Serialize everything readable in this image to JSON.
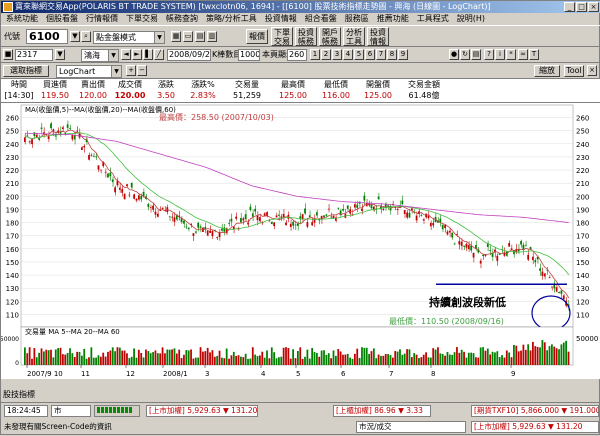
{
  "window": {
    "title": "寶來聯網交易App(POLARIS BT TRADE SYSTEM)  [twxclotn06, 1694]  - [[6100] 股票技術指標走勢圖 - 興海 (日線圖 - LogChart)]"
  },
  "menu": [
    "系統功能",
    "個股看盤",
    "行情報價",
    "下單交易",
    "帳務查詢",
    "策略/分析工具",
    "投資情報",
    "組合看盤",
    "服務區",
    "推薦功能",
    "工具程式",
    "說明(H)"
  ],
  "toolbar1": {
    "code_label": "代號",
    "code_value": "6100",
    "mode_value": "點金盤模式",
    "report_btn": "報價",
    "order_btn": "下單\n交易",
    "ledger_btn": "投資\n帳務",
    "cash_btn": "開戶\n帳務",
    "strategy_btn": "分析\n工具",
    "news_btn": "投資\n情報"
  },
  "toolbar2": {
    "code": "2317",
    "name": "鴻海",
    "date": "2008/09/26",
    "kline_label": "K棒數目",
    "kline_value": "1000",
    "display_label": "本頁顯示",
    "display_value": "260",
    "zoom_label": "縮放",
    "tool_label": "Tool"
  },
  "toolbar3": {
    "indicator_btn": "選取指標",
    "chart_type": "LogChart"
  },
  "quote": {
    "headers": [
      "時間",
      "買進價",
      "賣出價",
      "成交價",
      "漲跌",
      "漲跌%",
      "交易量",
      "最高價",
      "最低價",
      "開盤價",
      "交易金額"
    ],
    "values": [
      "[14:30]",
      "119.50",
      "120.00",
      "120.00",
      "3.50",
      "2.83%",
      "51,259",
      "125.00",
      "116.00",
      "125.00",
      "61.48億"
    ]
  },
  "chart": {
    "ma_legend": "MA(收盤價,5)--MA(收盤價,20)--MA(收盤價,60)",
    "high_label": "最高價：258.50 (2007/10/03)",
    "low_label": "最低價：110.50 (2008/09/16)",
    "annotation": "持續創波段新低",
    "volume_legend": "交易量 MA 5--MA 20--MA 60",
    "price_ticks": [
      "260",
      "250",
      "240",
      "230",
      "220",
      "210",
      "200",
      "190",
      "180",
      "170",
      "160",
      "150",
      "140",
      "130",
      "120",
      "110"
    ],
    "volume_ticks": [
      "50000",
      "0"
    ],
    "x_ticks": [
      "2007/9 10",
      "11",
      "12",
      "2008/1",
      "3",
      "4",
      "5",
      "6",
      "7",
      "8",
      "9"
    ],
    "colors": {
      "up": "#c00000",
      "down": "#008000",
      "ma5": "#c04040",
      "ma20": "#40c040",
      "ma60": "#c040c0",
      "support": "#0000a0"
    }
  },
  "chart_data": {
    "type": "candlestick",
    "title": "",
    "xlabel": "",
    "ylabel": "",
    "ylim": [
      110,
      265
    ],
    "x": [
      "2007/9",
      "2007/10",
      "2007/11",
      "2007/12",
      "2008/1",
      "2008/2",
      "2008/3",
      "2008/4",
      "2008/5",
      "2008/6",
      "2008/7",
      "2008/8",
      "2008/9"
    ],
    "close_approx": [
      245,
      252,
      210,
      190,
      170,
      185,
      182,
      190,
      195,
      180,
      155,
      162,
      120
    ],
    "ma60_approx": [
      248,
      247,
      242,
      232,
      222,
      208,
      200,
      196,
      194,
      190,
      186,
      184,
      180
    ],
    "annotations": {
      "high": {
        "value": 258.5,
        "date": "2007/10/03"
      },
      "low": {
        "value": 110.5,
        "date": "2008/09/16"
      },
      "support_line": 133
    }
  },
  "tabs": {
    "label": "股技指標"
  },
  "status": {
    "time": "18:24:45",
    "market": "市",
    "market_idx1": "[上市加權]  5,929.63  ▼ 131.20",
    "market_idx2": "[上櫃加權]  86.96  ▼ 3.33",
    "futures": "[期貨TXF10]  5,866.000  ▼ 191.000",
    "message": "未發現有關Screen-Code的資訊",
    "section": "市況/成交",
    "market_idx3": "[上市加權]  5,929.63  ▼ 131.20"
  }
}
